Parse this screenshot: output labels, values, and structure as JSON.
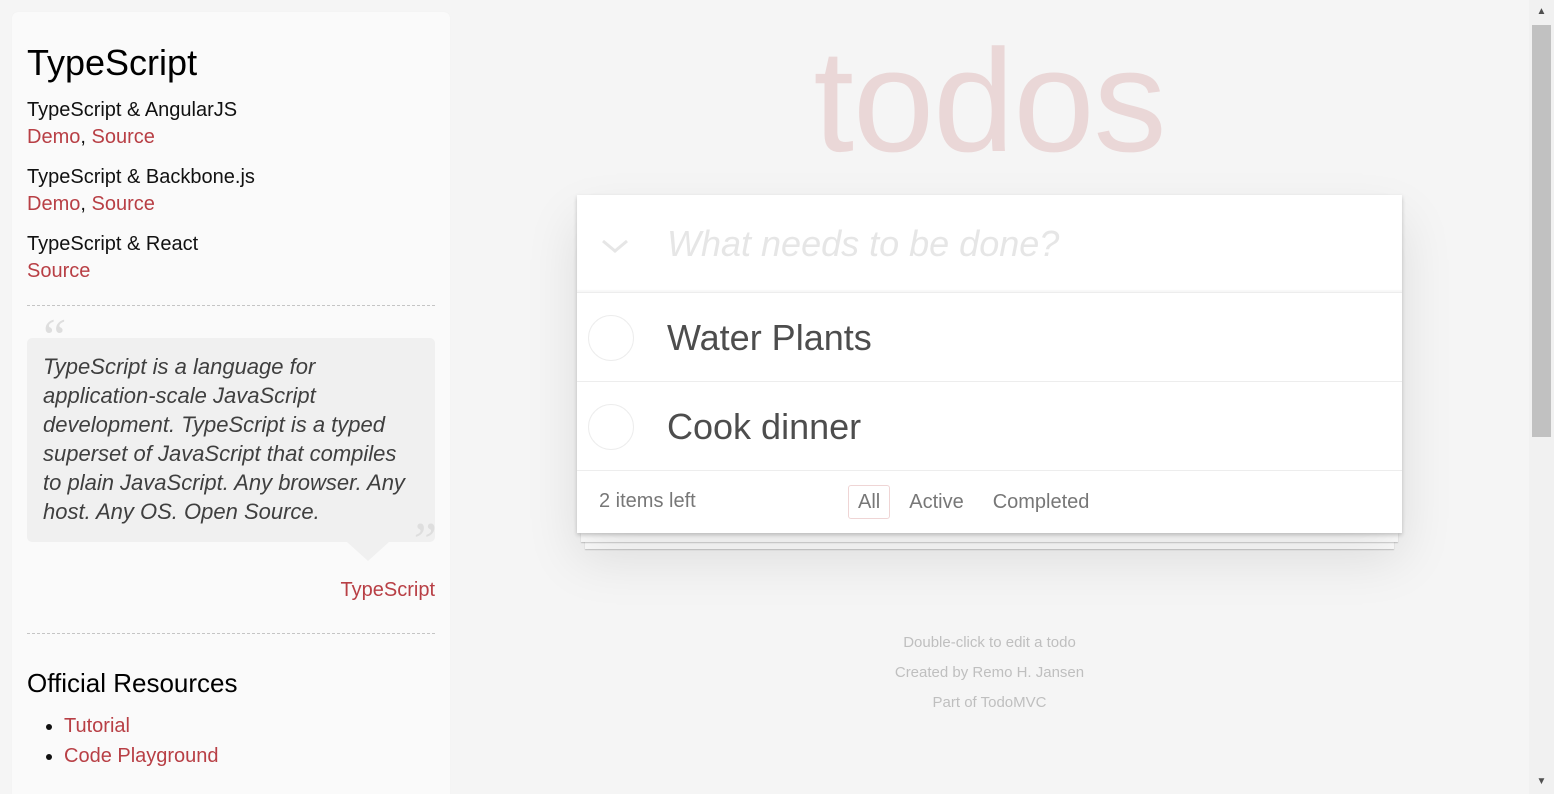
{
  "sidebar": {
    "title": "TypeScript",
    "examples": [
      {
        "title": "TypeScript & AngularJS",
        "links": [
          "Demo",
          "Source"
        ]
      },
      {
        "title": "TypeScript & Backbone.js",
        "links": [
          "Demo",
          "Source"
        ]
      },
      {
        "title": "TypeScript & React",
        "links": [
          "Source"
        ]
      }
    ],
    "link_separator": ",",
    "quote": {
      "open_mark": "“",
      "close_mark": "”",
      "text": "TypeScript is a language for application-scale JavaScript development. TypeScript is a typed superset of JavaScript that compiles to plain JavaScript. Any browser. Any host. Any OS. Open Source.",
      "source": "TypeScript"
    },
    "resources_heading": "Official Resources",
    "resources": [
      "Tutorial",
      "Code Playground"
    ]
  },
  "app": {
    "title": "todos",
    "new_todo_placeholder": "What needs to be done?",
    "todos": [
      "Water Plants",
      "Cook dinner"
    ],
    "items_left": "2 items left",
    "filters": [
      "All",
      "Active",
      "Completed"
    ],
    "selected_filter": "All"
  },
  "info": {
    "line1": "Double-click to edit a todo",
    "line2": "Created by Remo H. Jansen",
    "line3": "Part of TodoMVC"
  },
  "scrollbar": {
    "up_icon": "▲",
    "down_icon": "▼"
  },
  "colors": {
    "accent": "#b83f45",
    "title": "rgba(175, 47, 47, 0.15)",
    "background": "#f5f5f5"
  }
}
